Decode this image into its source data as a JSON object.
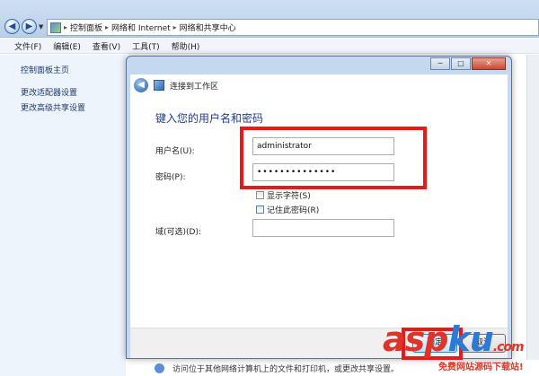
{
  "breadcrumb": [
    "控制面板",
    "网络和 Internet",
    "网络和共享中心"
  ],
  "menu": [
    "文件(F)",
    "编辑(E)",
    "查看(V)",
    "工具(T)",
    "帮助(H)"
  ],
  "sidebar": {
    "items": [
      "控制面板主页",
      "更改适配器设置",
      "更改高级共享设置"
    ]
  },
  "dialog": {
    "title": "连接到工作区",
    "heading": "键入您的用户名和密码",
    "username_label": "用户名(U):",
    "username_value": "administrator",
    "password_label": "密码(P):",
    "password_value": "••••••••••••••",
    "show_chars_label": "显示字符(S)",
    "remember_label": "记住此密码(R)",
    "domain_label": "域(可选)(D):",
    "domain_value": "",
    "ok_label": "确定",
    "cancel_label": "取消",
    "minimize_glyph": "─",
    "maximize_glyph": "□",
    "close_glyph": "✕"
  },
  "main": {
    "bottom_note": "访问位于其他网络计算机上的文件和打印机，或更改共享设置。"
  },
  "watermark": {
    "logo_left": "asp",
    "logo_right": "ku",
    "logo_suffix": ".com",
    "sub": "免费网站源码下载站!"
  },
  "colors": {
    "highlight": "#e41b1b",
    "heading": "#1e3d8f",
    "dialog_frame": "#c4d9ef"
  }
}
